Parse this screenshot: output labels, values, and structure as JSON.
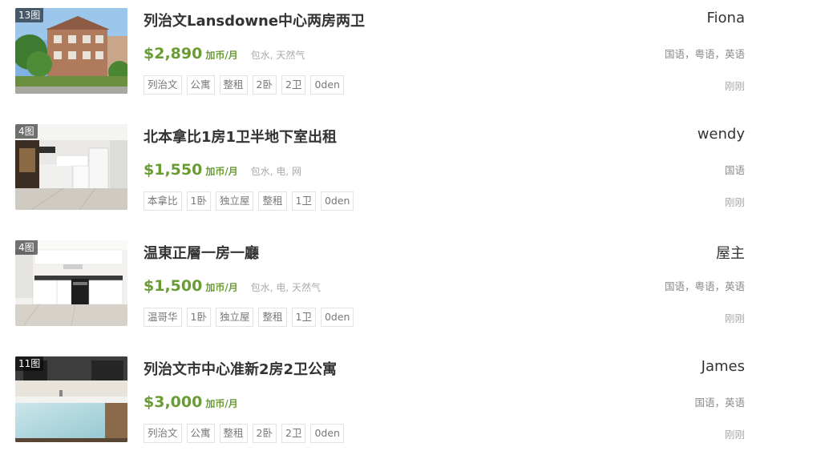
{
  "listings": [
    {
      "photo_count": "13图",
      "title": "列治文Lansdowne中心两房两卫",
      "price": "$2,890",
      "unit": "加币/月",
      "includes": "包水, 天然气",
      "tags": [
        "列治文",
        "公寓",
        "整租",
        "2卧",
        "2卫",
        "0den"
      ],
      "owner": "Fiona",
      "languages": "国语，粤语，英语",
      "time": "刚刚"
    },
    {
      "photo_count": "4图",
      "title": "北本拿比1房1卫半地下室出租",
      "price": "$1,550",
      "unit": "加币/月",
      "includes": "包水, 电, 网",
      "tags": [
        "本拿比",
        "1卧",
        "独立屋",
        "整租",
        "1卫",
        "0den"
      ],
      "owner": "wendy",
      "languages": "国语",
      "time": "刚刚"
    },
    {
      "photo_count": "4图",
      "title": "温東正層一房一廳",
      "price": "$1,500",
      "unit": "加币/月",
      "includes": "包水, 电, 天然气",
      "tags": [
        "温哥华",
        "1卧",
        "独立屋",
        "整租",
        "1卫",
        "0den"
      ],
      "owner": "屋主",
      "languages": "国语，粤语，英语",
      "time": "刚刚"
    },
    {
      "photo_count": "11图",
      "title": "列治文市中心准新2房2卫公寓",
      "price": "$3,000",
      "unit": "加币/月",
      "includes": "",
      "tags": [
        "列治文",
        "公寓",
        "整租",
        "2卧",
        "2卫",
        "0den"
      ],
      "owner": "James",
      "languages": "国语，英语",
      "time": "刚刚"
    }
  ]
}
